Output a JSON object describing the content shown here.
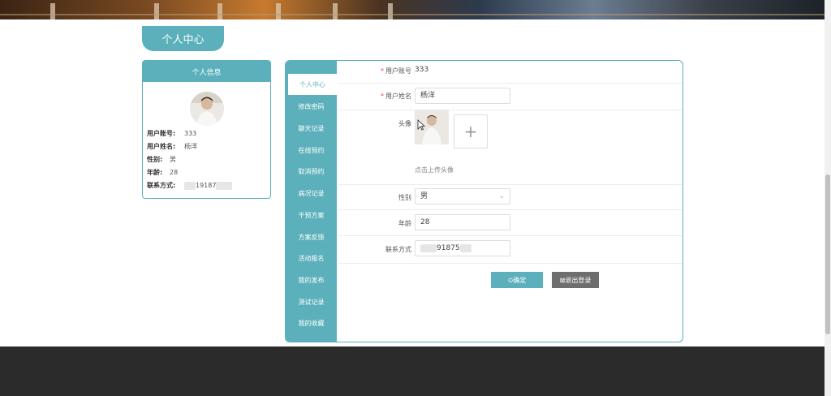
{
  "page_tab": "个人中心",
  "info_card": {
    "title": "个人信息",
    "rows": [
      {
        "label": "用户账号:",
        "value": "333"
      },
      {
        "label": "用户姓名:",
        "value": "杨洋"
      },
      {
        "label": "性别:",
        "value": "男"
      },
      {
        "label": "年龄:",
        "value": "28"
      },
      {
        "label": "联系方式:",
        "value": "19187"
      }
    ]
  },
  "menu": [
    {
      "label": "个人中心",
      "active": true
    },
    {
      "label": "修改密码"
    },
    {
      "label": "聊天记录"
    },
    {
      "label": "在线预约"
    },
    {
      "label": "取消预约"
    },
    {
      "label": "病况记录"
    },
    {
      "label": "干预方案"
    },
    {
      "label": "方案反馈"
    },
    {
      "label": "活动报名"
    },
    {
      "label": "我的发布"
    },
    {
      "label": "测试记录"
    },
    {
      "label": "我的收藏"
    }
  ],
  "form": {
    "account": {
      "label": "用户账号",
      "value": "333"
    },
    "name": {
      "label": "用户姓名",
      "value": "杨洋"
    },
    "avatar": {
      "label": "头像",
      "hint": "点击上传头像",
      "add_symbol": "+"
    },
    "gender": {
      "label": "性别",
      "value": "男"
    },
    "age": {
      "label": "年龄",
      "value": "28"
    },
    "phone": {
      "label": "联系方式",
      "value": "91875"
    }
  },
  "buttons": {
    "confirm": "⊙确定",
    "logout": "⊠退出登录"
  },
  "colors": {
    "accent": "#5bb0bb",
    "logout": "#6e6e6e",
    "footer": "#2b2b2b"
  }
}
